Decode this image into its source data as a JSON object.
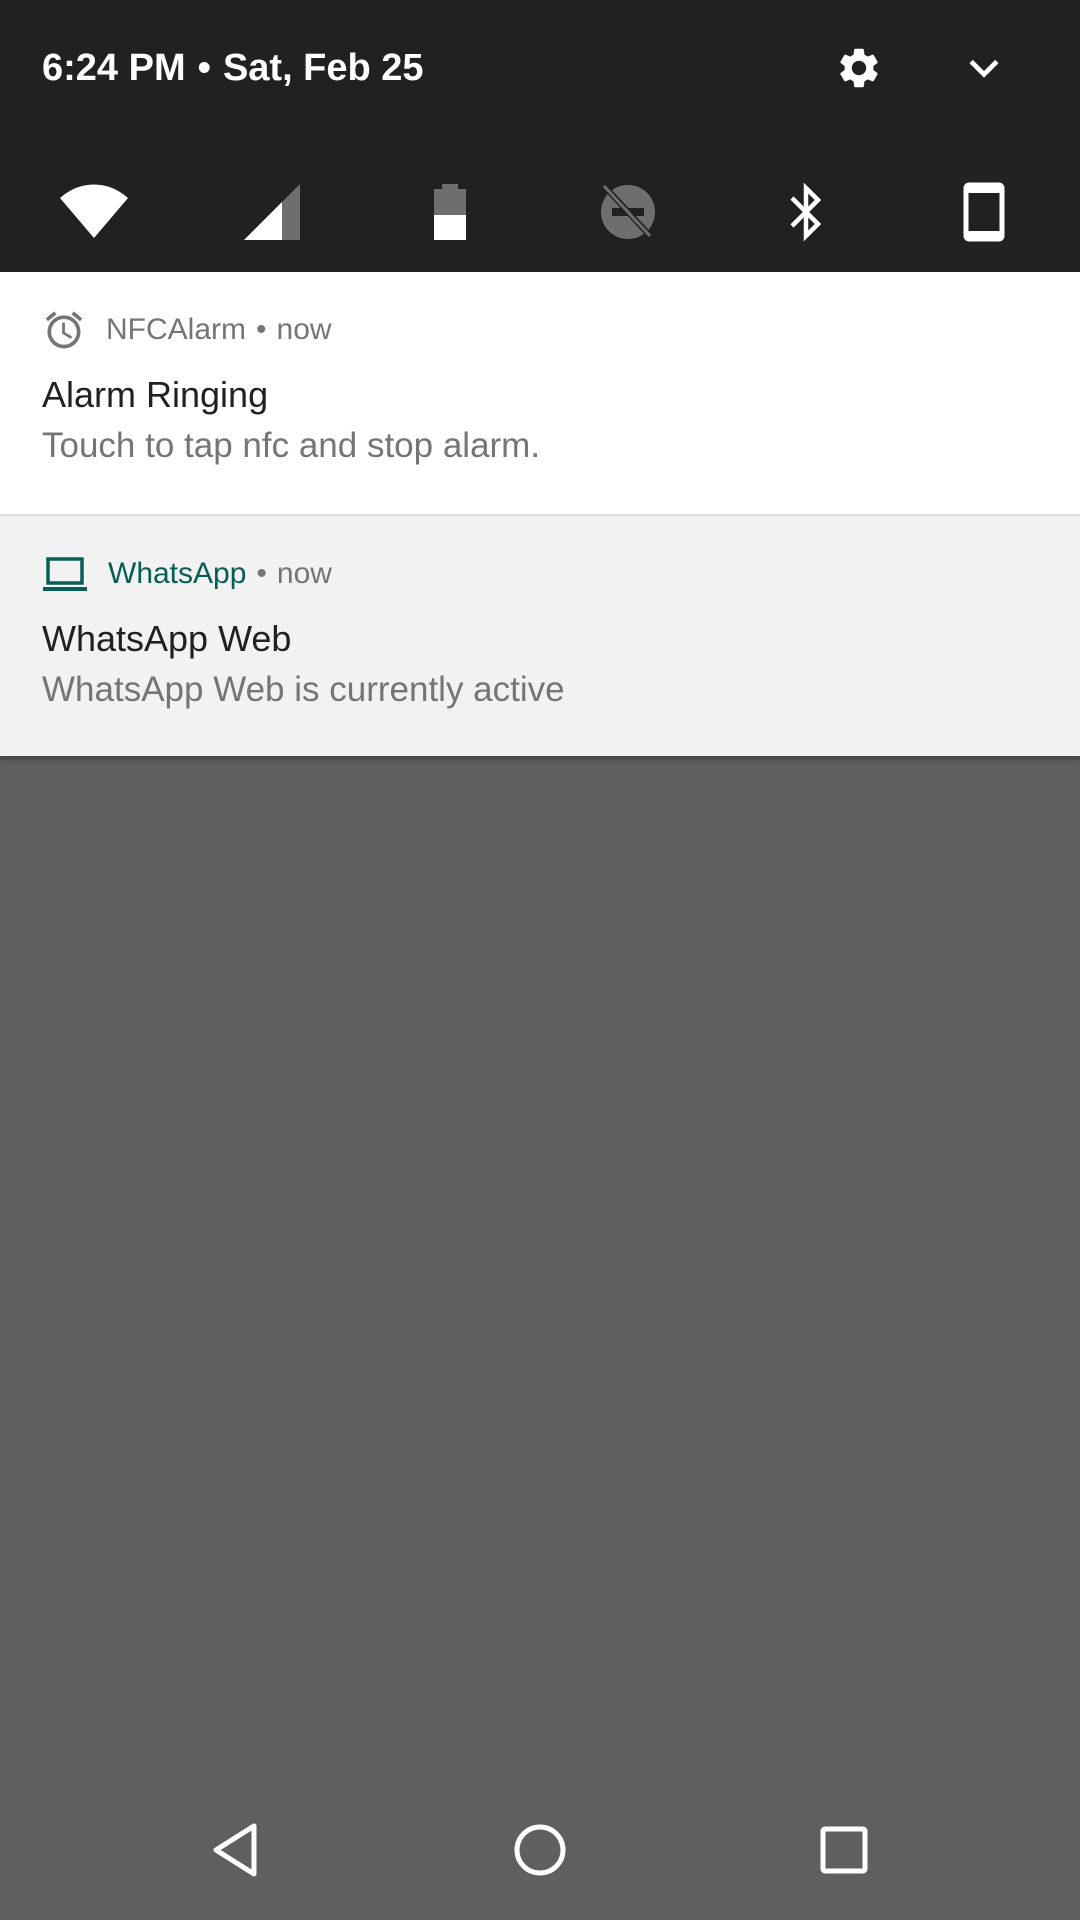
{
  "status": {
    "time": "6:24 PM",
    "separator": "•",
    "date": "Sat, Feb 25",
    "header_icons": [
      "gear-icon",
      "chevron-down-icon"
    ]
  },
  "quick_tiles": [
    {
      "name": "wifi-icon",
      "state": "on"
    },
    {
      "name": "cellular-signal-icon",
      "state": "partial"
    },
    {
      "name": "battery-icon",
      "state": "half"
    },
    {
      "name": "do-not-disturb-off-icon",
      "state": "off"
    },
    {
      "name": "bluetooth-icon",
      "state": "on"
    },
    {
      "name": "phone-rotation-icon",
      "state": "on"
    }
  ],
  "notifications": [
    {
      "icon": "alarm-clock-icon",
      "app": "NFCAlarm",
      "separator": "•",
      "time": "now",
      "title": "Alarm Ringing",
      "text": "Touch to tap nfc and stop alarm.",
      "app_color": "#757575"
    },
    {
      "icon": "laptop-icon",
      "app": "WhatsApp",
      "separator": "•",
      "time": "now",
      "title": "WhatsApp Web",
      "text": "WhatsApp Web is currently active",
      "app_color": "#075e54"
    }
  ],
  "navigation": [
    "back-icon",
    "home-icon",
    "recents-icon"
  ],
  "colors": {
    "shade_background": "#212121",
    "scrim": "#5f5f5f",
    "whatsapp_accent": "#075e54"
  }
}
